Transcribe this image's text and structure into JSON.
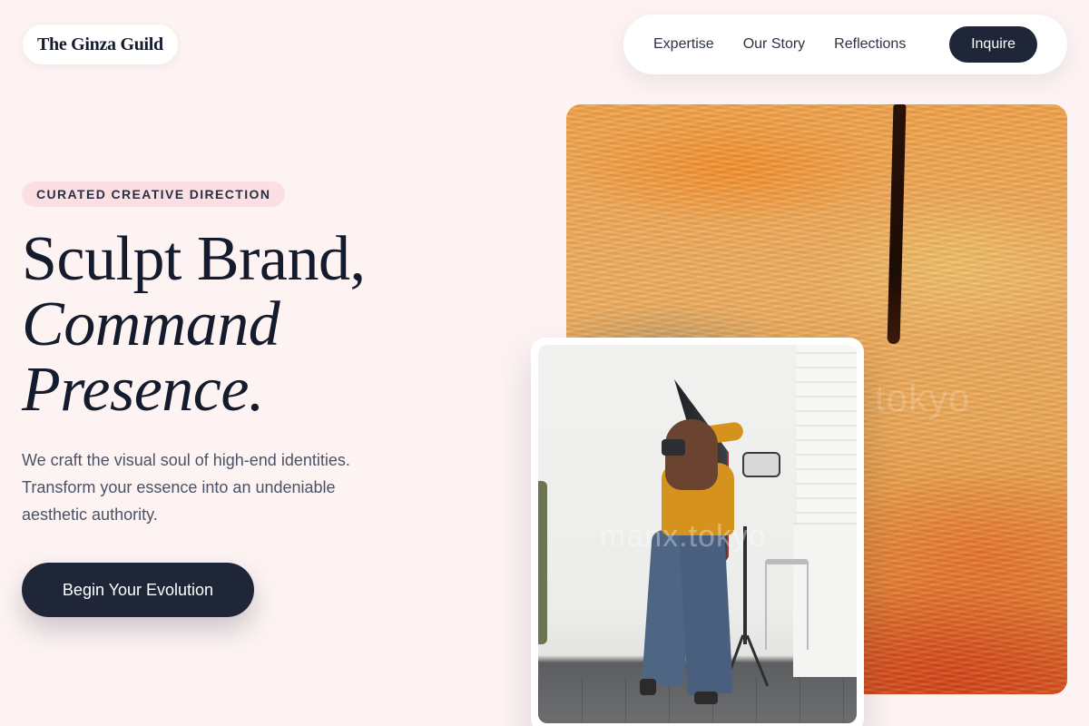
{
  "brand": {
    "name": "The Ginza Guild"
  },
  "nav": {
    "links": [
      "Expertise",
      "Our Story",
      "Reflections"
    ],
    "cta_label": "Inquire"
  },
  "hero": {
    "badge": "CURATED CREATIVE DIRECTION",
    "headline": {
      "line1": "Sculpt Brand,",
      "line2": "Command",
      "line3": "Presence."
    },
    "lede": "We craft the visual soul of high-end identities. Transform your essence into an undeniable aesthetic authority.",
    "cta_label": "Begin Your Evolution"
  },
  "media": {
    "painting_watermark": "tokyo",
    "photo_watermark": "manx.tokyo"
  },
  "colors": {
    "background": "#fdf3f3",
    "primary_dark": "#1e2638",
    "badge_bg": "#fbdfe3",
    "heading": "#141b2d",
    "body_text": "#4a5366"
  },
  "icons": []
}
